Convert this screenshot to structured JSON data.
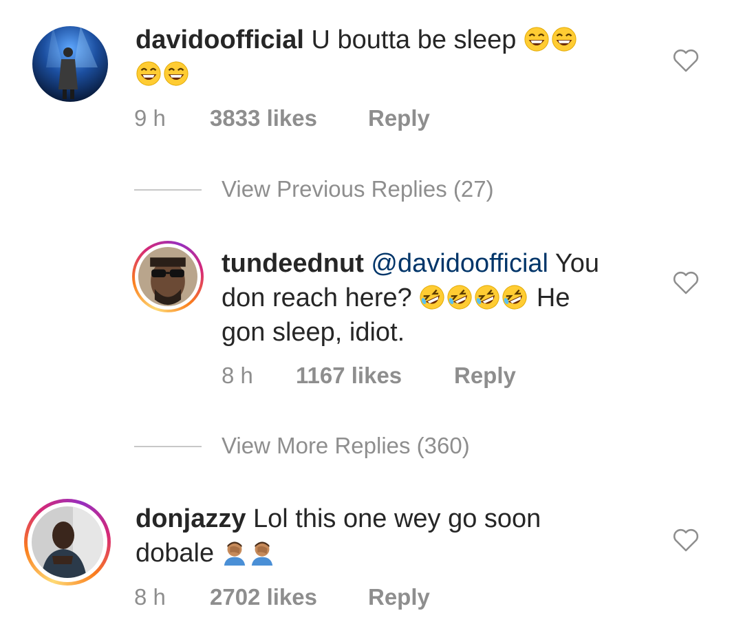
{
  "comments": [
    {
      "username": "davidoofficial",
      "text_parts": [
        "U boutta be sleep"
      ],
      "time": "9 h",
      "likes": "3833 likes",
      "reply_label": "Reply"
    },
    {
      "username": "tundeednut",
      "mention": "@davidoofficial",
      "text_parts": [
        "You",
        "don reach here?",
        "He",
        "gon sleep, idiot."
      ],
      "time": "8 h",
      "likes": "1167 likes",
      "reply_label": "Reply"
    },
    {
      "username": "donjazzy",
      "text_parts": [
        "Lol this one wey go soon",
        "dobale"
      ],
      "time": "8 h",
      "likes": "2702 likes",
      "reply_label": "Reply"
    }
  ],
  "view_previous_replies": "View Previous Replies (27)",
  "view_more_replies": "View More Replies (360)",
  "icons": {
    "like": "heart-outline-icon",
    "laughing": "grinning-squinting-face-icon",
    "rolling_laughing": "rolling-on-floor-laughing-icon",
    "facepalm": "man-facepalming-icon"
  },
  "colors": {
    "text": "#262626",
    "muted": "#8e8e8e",
    "mention": "#003569"
  }
}
